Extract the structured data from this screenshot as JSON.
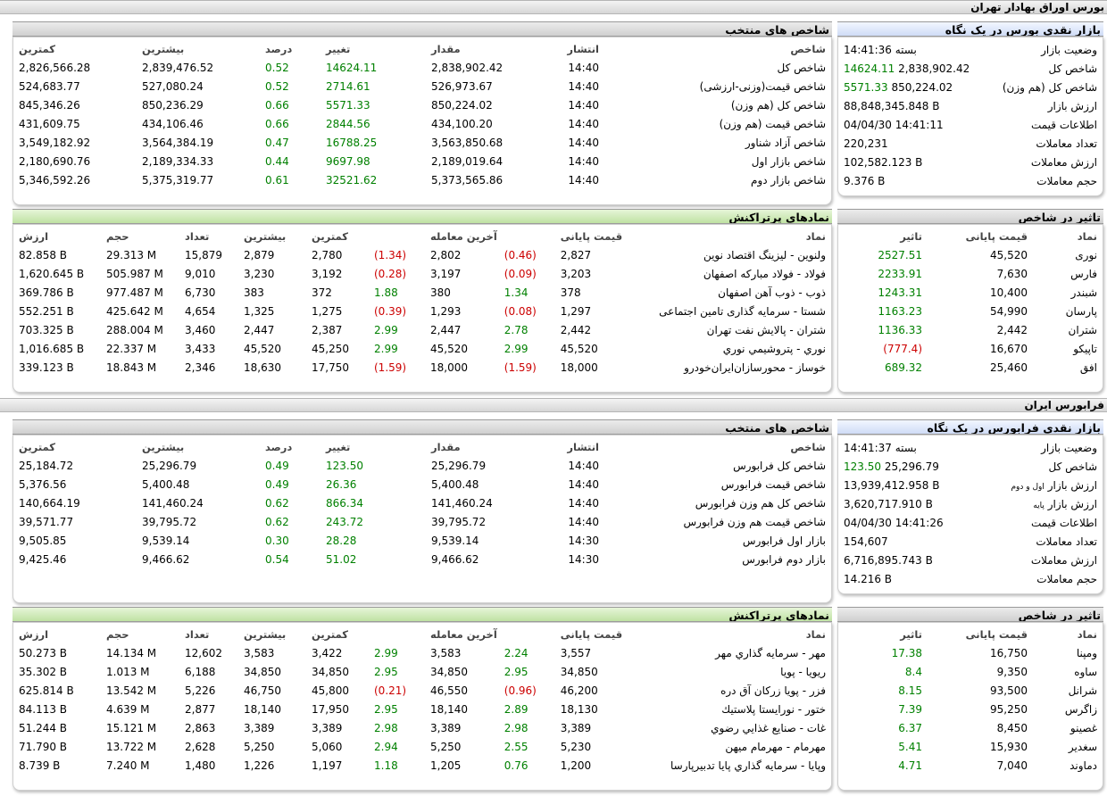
{
  "tse": {
    "title": "بورس اوراق بهادار تهران",
    "glance": {
      "title": "بازار نقدی بورس در یک نگاه",
      "rows": [
        {
          "label": "وضعیت بازار",
          "value": "بسته 14:41:36",
          "change": ""
        },
        {
          "label": "شاخص کل",
          "value": "2,838,902.42",
          "change": "14624.11"
        },
        {
          "label": "شاخص کل (هم وزن)",
          "value": "850,224.02",
          "change": "5571.33"
        },
        {
          "label": "ارزش بازار",
          "value": "88,848,345.848 B",
          "change": ""
        },
        {
          "label": "اطلاعات قیمت",
          "value": "04/04/30 14:41:11",
          "change": ""
        },
        {
          "label": "تعداد معاملات",
          "value": "220,231",
          "change": ""
        },
        {
          "label": "ارزش معاملات",
          "value": "102,582.123 B",
          "change": ""
        },
        {
          "label": "حجم معاملات",
          "value": "9.376 B",
          "change": ""
        }
      ]
    },
    "indices": {
      "title": "شاخص های منتخب",
      "headers": [
        "شاخص",
        "انتشار",
        "مقدار",
        "تغییر",
        "درصد",
        "بیشترین",
        "کمترین"
      ],
      "rows": [
        [
          "شاخص کل",
          "14:40",
          "2,838,902.42",
          "14624.11",
          "0.52",
          "2,839,476.52",
          "2,826,566.28"
        ],
        [
          "شاخص قیمت(وزنی-ارزشی)",
          "14:40",
          "526,973.67",
          "2714.61",
          "0.52",
          "527,080.24",
          "524,683.77"
        ],
        [
          "شاخص کل (هم وزن)",
          "14:40",
          "850,224.02",
          "5571.33",
          "0.66",
          "850,236.29",
          "845,346.26"
        ],
        [
          "شاخص قیمت (هم وزن)",
          "14:40",
          "434,100.20",
          "2844.56",
          "0.66",
          "434,106.46",
          "431,609.75"
        ],
        [
          "شاخص آزاد شناور",
          "14:40",
          "3,563,850.68",
          "16788.25",
          "0.47",
          "3,564,384.19",
          "3,549,182.92"
        ],
        [
          "شاخص بازار اول",
          "14:40",
          "2,189,019.64",
          "9697.98",
          "0.44",
          "2,189,334.33",
          "2,180,690.76"
        ],
        [
          "شاخص بازار دوم",
          "14:40",
          "5,373,565.86",
          "32521.62",
          "0.61",
          "5,375,319.77",
          "5,346,592.26"
        ]
      ]
    },
    "impact": {
      "title": "تاثیر در شاخص",
      "headers": [
        "نماد",
        "قیمت پایانی",
        "تاثیر"
      ],
      "rows": [
        [
          "نوری",
          "45,520",
          "2527.51"
        ],
        [
          "فارس",
          "7,630",
          "2233.91"
        ],
        [
          "شبندر",
          "10,400",
          "1243.31"
        ],
        [
          "پارسان",
          "54,990",
          "1163.23"
        ],
        [
          "شتران",
          "2,442",
          "1136.33"
        ],
        [
          "تاپیکو",
          "16,670",
          "(777.4)"
        ],
        [
          "افق",
          "25,460",
          "689.32"
        ]
      ]
    },
    "active": {
      "title": "نمادهای پرتراکنش",
      "headers": [
        "نماد",
        "قیمت پایانی",
        "",
        "آخرین معامله",
        "",
        "کمترین",
        "بیشترین",
        "تعداد",
        "حجم",
        "ارزش"
      ],
      "rows": [
        [
          "ولنوین - لیزینگ اقتصاد نوین",
          "2,827",
          "(0.46)",
          "2,802",
          "(1.34)",
          "2,780",
          "2,879",
          "15,879",
          "29.313 M",
          "82.858 B"
        ],
        [
          "فولاد - فولاد مبارکه اصفهان",
          "3,203",
          "(0.09)",
          "3,197",
          "(0.28)",
          "3,192",
          "3,230",
          "9,010",
          "505.987 M",
          "1,620.645 B"
        ],
        [
          "ذوب - ذوب آهن اصفهان",
          "378",
          "1.34",
          "380",
          "1.88",
          "372",
          "383",
          "6,730",
          "977.487 M",
          "369.786 B"
        ],
        [
          "شستا - سرمایه گذاری تامین اجتماعی",
          "1,297",
          "(0.08)",
          "1,293",
          "(0.39)",
          "1,275",
          "1,325",
          "4,654",
          "425.642 M",
          "552.251 B"
        ],
        [
          "شتران - پالایش نفت تهران",
          "2,442",
          "2.78",
          "2,447",
          "2.99",
          "2,387",
          "2,447",
          "3,460",
          "288.004 M",
          "703.325 B"
        ],
        [
          "نوري - پتروشیمي نوري",
          "45,520",
          "2.99",
          "45,520",
          "2.99",
          "45,250",
          "45,520",
          "3,433",
          "22.337 M",
          "1,016.685 B"
        ],
        [
          "خوساز - محورسازان‌ایران‌خودرو",
          "18,000",
          "(1.59)",
          "18,000",
          "(1.59)",
          "17,750",
          "18,630",
          "2,346",
          "18.843 M",
          "339.123 B"
        ]
      ]
    }
  },
  "ifb": {
    "title": "فرابورس ایران",
    "glance": {
      "title": "بازار نقدی فرابورس در یک نگاه",
      "rows": [
        {
          "label": "وضعیت بازار",
          "value": "بسته 14:41:37",
          "change": "",
          "small": ""
        },
        {
          "label": "شاخص کل",
          "value": "25,296.79",
          "change": "123.50",
          "small": ""
        },
        {
          "label": "ارزش بازار",
          "value": "13,939,412.958 B",
          "change": "",
          "small": "اول و دوم"
        },
        {
          "label": "ارزش بازار",
          "value": "3,620,717.910 B",
          "change": "",
          "small": "پایه"
        },
        {
          "label": "اطلاعات قیمت",
          "value": "04/04/30 14:41:26",
          "change": "",
          "small": ""
        },
        {
          "label": "تعداد معاملات",
          "value": "154,607",
          "change": "",
          "small": ""
        },
        {
          "label": "ارزش معاملات",
          "value": "6,716,895.743 B",
          "change": "",
          "small": ""
        },
        {
          "label": "حجم معاملات",
          "value": "14.216 B",
          "change": "",
          "small": ""
        }
      ]
    },
    "indices": {
      "title": "شاخص های منتخب",
      "headers": [
        "شاخص",
        "انتشار",
        "مقدار",
        "تغییر",
        "درصد",
        "بیشترین",
        "کمترین"
      ],
      "rows": [
        [
          "شاخص کل فرابورس",
          "14:40",
          "25,296.79",
          "123.50",
          "0.49",
          "25,296.79",
          "25,184.72"
        ],
        [
          "شاخص قیمت فرابورس",
          "14:40",
          "5,400.48",
          "26.36",
          "0.49",
          "5,400.48",
          "5,376.56"
        ],
        [
          "شاخص کل هم وزن فرابورس",
          "14:40",
          "141,460.24",
          "866.34",
          "0.62",
          "141,460.24",
          "140,664.19"
        ],
        [
          "شاخص قیمت هم وزن فرابورس",
          "14:40",
          "39,795.72",
          "243.72",
          "0.62",
          "39,795.72",
          "39,571.77"
        ],
        [
          "بازار اول فرابورس",
          "14:30",
          "9,539.14",
          "28.28",
          "0.30",
          "9,539.14",
          "9,505.85"
        ],
        [
          "بازار دوم فرابورس",
          "14:30",
          "9,466.62",
          "51.02",
          "0.54",
          "9,466.62",
          "9,425.46"
        ]
      ]
    },
    "impact": {
      "title": "تاثیر در شاخص",
      "headers": [
        "نماد",
        "قیمت پایانی",
        "تاثیر"
      ],
      "rows": [
        [
          "ومپنا",
          "16,750",
          "17.38"
        ],
        [
          "ساوه",
          "9,350",
          "8.4"
        ],
        [
          "شرانل",
          "93,500",
          "8.15"
        ],
        [
          "زاگرس",
          "95,250",
          "7.39"
        ],
        [
          "غصینو",
          "8,450",
          "6.37"
        ],
        [
          "سغدیر",
          "15,930",
          "5.41"
        ],
        [
          "دماوند",
          "7,040",
          "4.71"
        ]
      ]
    },
    "active": {
      "title": "نمادهای پرتراکنش",
      "headers": [
        "نماد",
        "قیمت پایانی",
        "",
        "آخرین معامله",
        "",
        "کمترین",
        "بیشترین",
        "تعداد",
        "حجم",
        "ارزش"
      ],
      "rows": [
        [
          "مهر - سرمایه گذاري مهر",
          "3,557",
          "2.24",
          "3,583",
          "2.99",
          "3,422",
          "3,583",
          "12,602",
          "14.134 M",
          "50.273 B"
        ],
        [
          "ریویا - پویا",
          "34,850",
          "2.95",
          "34,850",
          "2.95",
          "34,850",
          "34,850",
          "6,188",
          "1.013 M",
          "35.302 B"
        ],
        [
          "فزر - پويا زركان آق دره",
          "46,200",
          "(0.96)",
          "46,550",
          "(0.21)",
          "45,800",
          "46,750",
          "5,226",
          "13.542 M",
          "625.814 B"
        ],
        [
          "ختور - نورايستا پلاستيك",
          "18,130",
          "2.89",
          "18,140",
          "2.95",
          "17,950",
          "18,140",
          "2,877",
          "4.639 M",
          "84.113 B"
        ],
        [
          "غات - صنايع غذايي رضوي",
          "3,389",
          "2.98",
          "3,389",
          "2.98",
          "3,389",
          "3,389",
          "2,863",
          "15.121 M",
          "51.244 B"
        ],
        [
          "مهرمام - مهرمام میهن",
          "5,230",
          "2.55",
          "5,250",
          "2.94",
          "5,060",
          "5,250",
          "2,628",
          "13.722 M",
          "71.790 B"
        ],
        [
          "وپايا - سرمايه گذاري پايا تدبيرپارسا",
          "1,200",
          "0.76",
          "1,205",
          "1.18",
          "1,197",
          "1,226",
          "1,480",
          "7.240 M",
          "8.739 B"
        ]
      ]
    }
  }
}
